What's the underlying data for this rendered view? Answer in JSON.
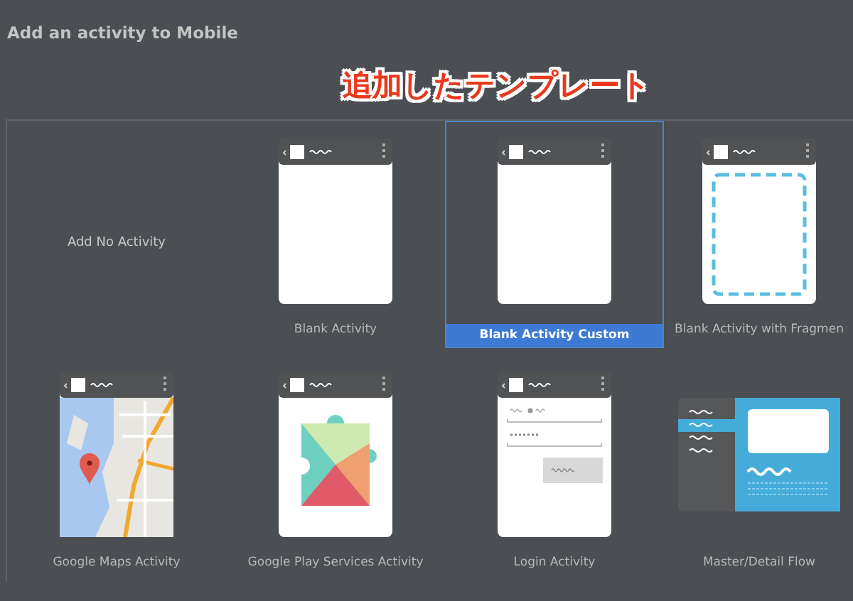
{
  "header": {
    "title": "Add an activity to Mobile"
  },
  "annotation": "追加したテンプレート",
  "templates": [
    {
      "label": "Add No Activity",
      "kind": "none",
      "selected": false
    },
    {
      "label": "Blank Activity",
      "kind": "blank",
      "selected": false
    },
    {
      "label": "Blank Activity Custom",
      "kind": "blank",
      "selected": true
    },
    {
      "label": "Blank Activity with Fragmen",
      "kind": "fragment",
      "selected": false
    },
    {
      "label": "Google Maps Activity",
      "kind": "maps",
      "selected": false
    },
    {
      "label": "Google Play Services Activity",
      "kind": "play",
      "selected": false
    },
    {
      "label": "Login Activity",
      "kind": "login",
      "selected": false
    },
    {
      "label": "Master/Detail Flow",
      "kind": "masterdetail",
      "selected": false
    }
  ]
}
